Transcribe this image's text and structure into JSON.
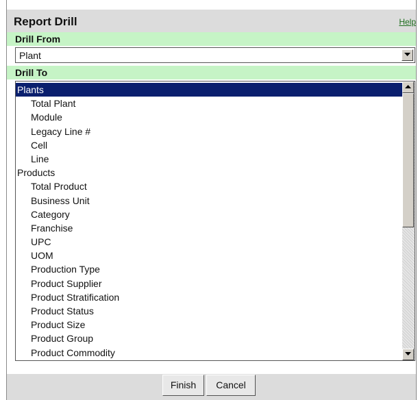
{
  "dialog": {
    "title": "Report Drill",
    "help_label": "Help"
  },
  "drill_from": {
    "label": "Drill From",
    "selected_value": "Plant"
  },
  "drill_to": {
    "label": "Drill To",
    "items": [
      {
        "label": "Plants",
        "level": 0,
        "selected": true
      },
      {
        "label": "Total Plant",
        "level": 1
      },
      {
        "label": "Module",
        "level": 1
      },
      {
        "label": "Legacy Line #",
        "level": 1
      },
      {
        "label": "Cell",
        "level": 1
      },
      {
        "label": "Line",
        "level": 1
      },
      {
        "label": "Products",
        "level": 0
      },
      {
        "label": "Total Product",
        "level": 1
      },
      {
        "label": "Business Unit",
        "level": 1
      },
      {
        "label": "Category",
        "level": 1
      },
      {
        "label": "Franchise",
        "level": 1
      },
      {
        "label": "UPC",
        "level": 1
      },
      {
        "label": "UOM",
        "level": 1
      },
      {
        "label": "Production Type",
        "level": 1
      },
      {
        "label": "Product Supplier",
        "level": 1
      },
      {
        "label": "Product Stratification",
        "level": 1
      },
      {
        "label": "Product Status",
        "level": 1
      },
      {
        "label": "Product Size",
        "level": 1
      },
      {
        "label": "Product Group",
        "level": 1
      },
      {
        "label": "Product Commodity",
        "level": 1
      }
    ]
  },
  "footer": {
    "finish_label": "Finish",
    "cancel_label": "Cancel"
  },
  "colors": {
    "section_bg": "#c6f4c6",
    "selected_bg": "#0a1f6e",
    "help_link": "#1d6d1d"
  }
}
